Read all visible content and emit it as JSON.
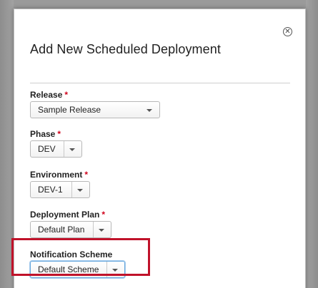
{
  "dialog": {
    "title": "Add New Scheduled Deployment",
    "close_glyph": "✕"
  },
  "fields": {
    "release": {
      "label": "Release",
      "required": "*",
      "value": "Sample Release"
    },
    "phase": {
      "label": "Phase",
      "required": "*",
      "value": "DEV"
    },
    "environment": {
      "label": "Environment",
      "required": "*",
      "value": "DEV-1"
    },
    "deployment_plan": {
      "label": "Deployment Plan",
      "required": "*",
      "value": "Default Plan"
    },
    "notification_scheme": {
      "label": "Notification Scheme",
      "value": "Default Scheme"
    }
  },
  "colors": {
    "required": "#d0021b",
    "highlight": "#c0122a",
    "focus": "#66a7dd"
  }
}
